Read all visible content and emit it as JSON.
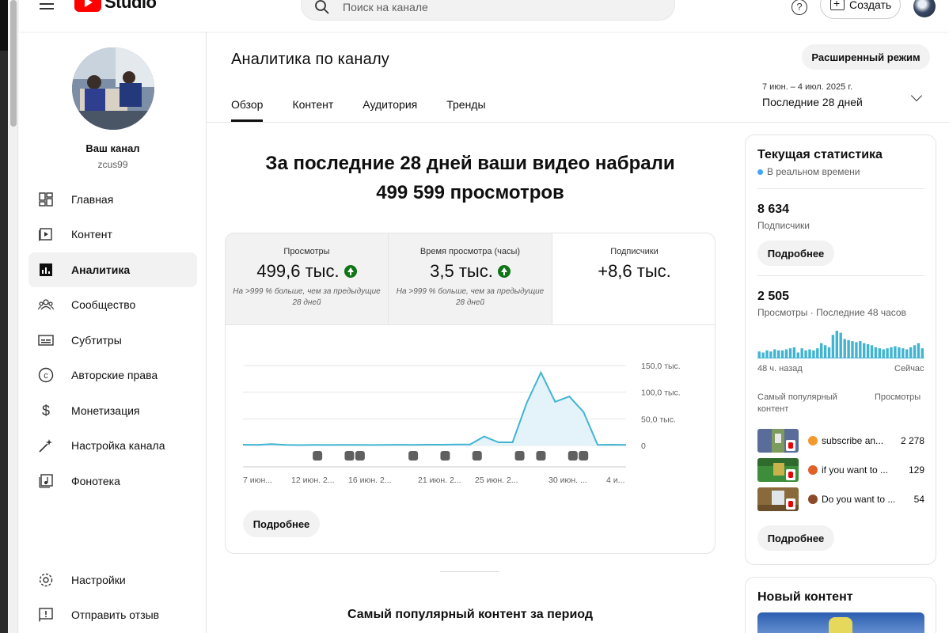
{
  "app": {
    "logo_text": "Studio",
    "search_placeholder": "Поиск на канале",
    "help_glyph": "?",
    "create_label": "Создать"
  },
  "channel": {
    "name": "Ваш канал",
    "handle": "zcus99"
  },
  "sidebar": {
    "items": [
      {
        "label": "Главная",
        "icon": "dashboard-icon"
      },
      {
        "label": "Контент",
        "icon": "content-icon"
      },
      {
        "label": "Аналитика",
        "icon": "analytics-icon",
        "active": true
      },
      {
        "label": "Сообщество",
        "icon": "community-icon"
      },
      {
        "label": "Субтитры",
        "icon": "subtitles-icon"
      },
      {
        "label": "Авторские права",
        "icon": "copyright-icon"
      },
      {
        "label": "Монетизация",
        "icon": "monetization-icon"
      },
      {
        "label": "Настройка канала",
        "icon": "customization-icon"
      },
      {
        "label": "Фонотека",
        "icon": "audio-library-icon"
      }
    ],
    "bottom": [
      {
        "label": "Настройки",
        "icon": "settings-icon"
      },
      {
        "label": "Отправить отзыв",
        "icon": "feedback-icon"
      }
    ]
  },
  "main": {
    "title": "Аналитика по каналу",
    "advanced_button": "Расширенный режим",
    "tabs": [
      "Обзор",
      "Контент",
      "Аудитория",
      "Тренды"
    ],
    "active_tab": 0,
    "date_range": {
      "dates": "7 июн. – 4 июл. 2025 г.",
      "label": "Последние 28 дней"
    },
    "headline_line1": "За последние 28 дней ваши видео набрали",
    "headline_line2": "499 599 просмотров",
    "metrics": [
      {
        "label": "Просмотры",
        "value": "499,6 тыс.",
        "up": true,
        "note_line1": "На >999 % больше, чем за предыдущие",
        "note_line2": "28 дней"
      },
      {
        "label": "Время просмотра (часы)",
        "value": "3,5 тыс.",
        "up": true,
        "note_line1": "На >999 % больше, чем за предыдущие",
        "note_line2": "28 дней"
      },
      {
        "label": "Подписчики",
        "value": "+8,6 тыс.",
        "up": false,
        "note_line1": "",
        "note_line2": ""
      }
    ],
    "more_button": "Подробнее",
    "popular_title": "Самый популярный контент за период"
  },
  "chart_data": {
    "type": "area",
    "x_labels": [
      "7 июн...",
      "12 июн. 2...",
      "16 июн. 2...",
      "21 июн. 2...",
      "25 июн. 2...",
      "30 июн. ...",
      "4 и..."
    ],
    "y_tick_labels": [
      "150,0 тыс.",
      "100,0 тыс.",
      "50,0 тыс.",
      "0"
    ],
    "ylim": [
      0,
      150000
    ],
    "days": 28,
    "values": [
      1500,
      1200,
      2500,
      1000,
      800,
      1000,
      900,
      1200,
      1000,
      900,
      1200,
      1400,
      1000,
      1500,
      1500,
      1800,
      2000,
      17000,
      6000,
      6000,
      80000,
      137000,
      82000,
      92000,
      63000,
      1000,
      1500,
      1200
    ],
    "series_color": "#41b4d2",
    "fill_color": "#e3f3f9",
    "upload_marker_days": [
      7,
      10,
      11,
      16,
      19,
      22,
      26,
      28,
      31,
      32
    ],
    "grid": true
  },
  "realtime": {
    "title": "Текущая статистика",
    "live_label": "В реальном времени",
    "subscribers_value": "8 634",
    "subscribers_label": "Подписчики",
    "more_button": "Подробнее",
    "views_value": "2 505",
    "views_label": "Просмотры · Последние 48 часов",
    "bars": [
      6,
      5,
      7,
      6,
      8,
      7,
      7,
      8,
      9,
      10,
      5,
      9,
      7,
      8,
      7,
      9,
      14,
      12,
      10,
      22,
      26,
      24,
      18,
      17,
      16,
      15,
      16,
      14,
      13,
      12,
      10,
      9,
      8,
      9,
      10,
      11,
      10,
      9,
      8,
      10,
      12,
      14,
      9
    ],
    "axis_left": "48 ч. назад",
    "axis_right": "Сейчас",
    "top_content_label_line1": "Самый популярный",
    "top_content_label_line2": "контент",
    "top_views_label": "Просмотры",
    "top_content": [
      {
        "title": "subscribe an...",
        "views": "2 278",
        "emoji_color": "#f29a2e",
        "thumb_color": "#5a6d9a"
      },
      {
        "title": "if you want to ...",
        "views": "129",
        "emoji_color": "#e0602a",
        "thumb_color": "#3e8d3a"
      },
      {
        "title": "Do you want to ...",
        "views": "54",
        "emoji_color": "#8a4b2a",
        "thumb_color": "#8a6a3a"
      }
    ],
    "more_button_2": "Подробнее"
  },
  "new_content": {
    "title": "Новый контент"
  }
}
